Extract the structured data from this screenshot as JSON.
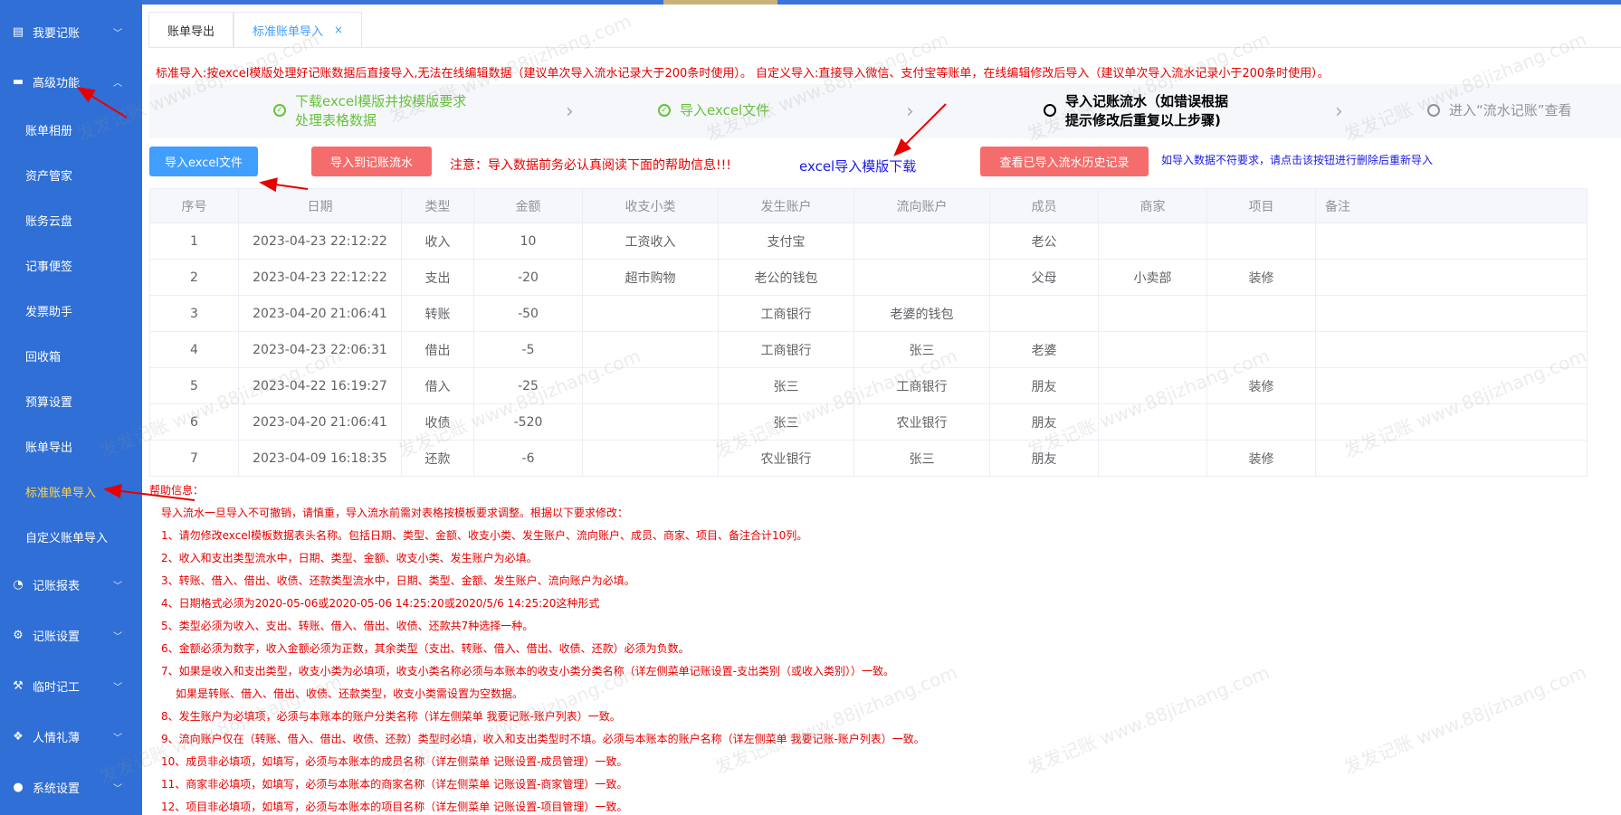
{
  "sidebar": {
    "items": [
      {
        "label": "我要记账",
        "icon": "ledger-icon",
        "expanded": false
      },
      {
        "label": "高级功能",
        "icon": "briefcase-icon",
        "expanded": true
      },
      {
        "label": "记账报表",
        "icon": "pie-chart-icon",
        "expanded": false
      },
      {
        "label": "记账设置",
        "icon": "gear-icon",
        "expanded": false
      },
      {
        "label": "临时记工",
        "icon": "tools-icon",
        "expanded": false
      },
      {
        "label": "人情礼薄",
        "icon": "gift-icon",
        "expanded": false
      },
      {
        "label": "系统设置",
        "icon": "user-icon",
        "expanded": false
      }
    ],
    "subitems": [
      "账单相册",
      "资产管家",
      "账务云盘",
      "记事便签",
      "发票助手",
      "回收箱",
      "预算设置",
      "账单导出",
      "标准账单导入",
      "自定义账单导入"
    ],
    "active_subitem": "标准账单导入"
  },
  "tabs": [
    {
      "label": "账单导出",
      "active": false
    },
    {
      "label": "标准账单导入",
      "active": true,
      "close": "×"
    }
  ],
  "notice": "标准导入:按excel模版处理好记账数据后直接导入,无法在线编辑数据（建议单次导入流水记录大于200条时使用）。    自定义导入:直接导入微信、支付宝等账单，在线编辑修改后导入（建议单次导入流水记录小于200条时使用）。",
  "steps": [
    {
      "line1": "下载excel模版并按模版要求",
      "line2": "处理表格数据",
      "status": "done"
    },
    {
      "line1": "导入excel文件",
      "line2": "",
      "status": "done"
    },
    {
      "line1": "导入记账流水（如错误根据",
      "line2": "提示修改后重复以上步骤)",
      "status": "current"
    },
    {
      "line1": "进入“流水记账”查看",
      "line2": "",
      "status": "pending"
    }
  ],
  "actions": {
    "import_excel": "导入excel文件",
    "import_flow": "导入到记账流水",
    "warning": "注意：导入数据前务必认真阅读下面的帮助信息!!!",
    "download_template": "excel导入模版下载",
    "view_history": "查看已导入流水历史记录",
    "hint": "如导入数据不符要求，请点击该按钮进行删除后重新导入"
  },
  "table": {
    "columns": [
      "序号",
      "日期",
      "类型",
      "金额",
      "收支小类",
      "发生账户",
      "流向账户",
      "成员",
      "商家",
      "项目",
      "备注"
    ],
    "rows": [
      [
        "1",
        "2023-04-23 22:12:22",
        "收入",
        "10",
        "工资收入",
        "支付宝",
        "",
        "老公",
        "",
        "",
        ""
      ],
      [
        "2",
        "2023-04-23 22:12:22",
        "支出",
        "-20",
        "超市购物",
        "老公的钱包",
        "",
        "父母",
        "小卖部",
        "装修",
        ""
      ],
      [
        "3",
        "2023-04-20 21:06:41",
        "转账",
        "-50",
        "",
        "工商银行",
        "老婆的钱包",
        "",
        "",
        "",
        ""
      ],
      [
        "4",
        "2023-04-23 22:06:31",
        "借出",
        "-5",
        "",
        "工商银行",
        "张三",
        "老婆",
        "",
        "",
        ""
      ],
      [
        "5",
        "2023-04-22 16:19:27",
        "借入",
        "-25",
        "",
        "张三",
        "工商银行",
        "朋友",
        "",
        "装修",
        ""
      ],
      [
        "6",
        "2023-04-20 21:06:41",
        "收债",
        "-520",
        "",
        "张三",
        "农业银行",
        "朋友",
        "",
        "",
        ""
      ],
      [
        "7",
        "2023-04-09 16:18:35",
        "还款",
        "-6",
        "",
        "农业银行",
        "张三",
        "朋友",
        "",
        "装修",
        ""
      ]
    ]
  },
  "help": {
    "title": "帮助信息：",
    "lines": [
      "导入流水一旦导入不可撤销，请慎重，导入流水前需对表格按模板要求调整。根据以下要求修改：",
      "1、请勿修改excel模板数据表头名称。包括日期、类型、金额、收支小类、发生账户、流向账户、成员、商家、项目、备注合计10列。",
      "2、收入和支出类型流水中，日期、类型、金额、收支小类、发生账户为必填。",
      "3、转账、借入、借出、收债、还款类型流水中，日期、类型、金额、发生账户、流向账户为必填。",
      "4、日期格式必须为2020-05-06或2020-05-06 14:25:20或2020/5/6 14:25:20这种形式",
      "5、类型必须为收入、支出、转账、借入、借出、收债、还款共7种选择一种。",
      "6、金额必须为数字，收入金额必须为正数，其余类型（支出、转账、借入、借出、收债、还款）必须为负数。",
      "7、如果是收入和支出类型，收支小类为必填项，收支小类名称必须与本账本的收支小类分类名称（详左侧菜单记账设置-支出类别（或收入类别））一致。",
      "如果是转账、借入、借出、收债、还款类型，收支小类需设置为空数据。",
      "8、发生账户为必填项，必须与本账本的账户分类名称（详左侧菜单 我要记账-账户列表）一致。",
      "9、流向账户仅在（转账、借入、借出、收债、还款）类型时必填，收入和支出类型时不填。必须与本账本的账户名称（详左侧菜单 我要记账-账户列表）一致。",
      "10、成员非必填项，如填写，必须与本账本的成员名称（详左侧菜单 记账设置-成员管理）一致。",
      "11、商家非必填项，如填写，必须与本账本的商家名称（详左侧菜单 记账设置-商家管理）一致。",
      "12、项目非必填项，如填写，必须与本账本的项目名称（详左侧菜单 记账设置-项目管理）一致。"
    ]
  },
  "watermark": "发发记账 www.88jizhang.com",
  "colors": {
    "sidebar": "#2f6fd6",
    "accent": "#409eff",
    "danger": "#f56c6c",
    "alert": "#e60000",
    "success": "#67c23a"
  }
}
